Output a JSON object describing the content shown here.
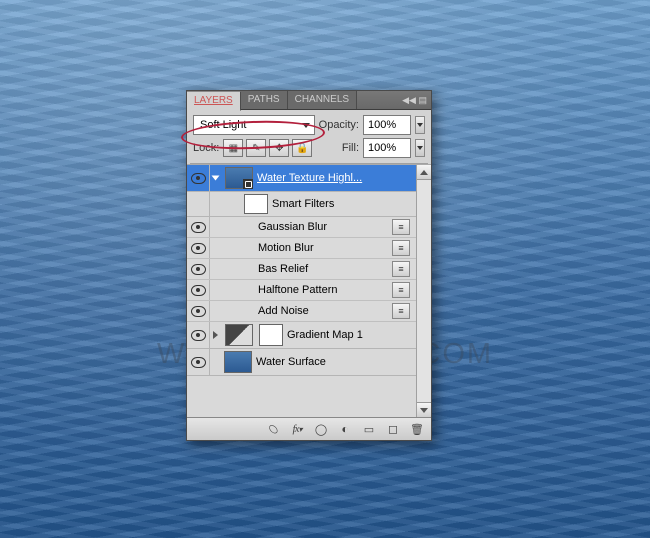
{
  "background_watermark": "WWW.PSDDUDE.COM",
  "panel": {
    "tabs": {
      "layers": "LAYERS",
      "paths": "PATHS",
      "channels": "CHANNELS"
    },
    "active_tab": "layers",
    "blend_mode": "Soft Light",
    "opacity_label": "Opacity:",
    "opacity_value": "100%",
    "lock_label": "Lock:",
    "fill_label": "Fill:",
    "fill_value": "100%"
  },
  "layers": {
    "selected": {
      "name": "Water Texture Highl...",
      "visible": true,
      "smart_object": true,
      "expanded": true
    },
    "smart_filters_label": "Smart Filters",
    "filters": [
      {
        "name": "Gaussian Blur",
        "visible": true
      },
      {
        "name": "Motion Blur",
        "visible": true
      },
      {
        "name": "Bas Relief",
        "visible": true
      },
      {
        "name": "Halftone Pattern",
        "visible": true
      },
      {
        "name": "Add Noise",
        "visible": true
      }
    ],
    "adjustment": {
      "name": "Gradient Map 1",
      "visible": true,
      "expanded": false
    },
    "surface": {
      "name": "Water Surface",
      "visible": true
    }
  },
  "bottom_icons": [
    "link",
    "fx",
    "mask",
    "adjustment",
    "group",
    "new",
    "trash"
  ]
}
